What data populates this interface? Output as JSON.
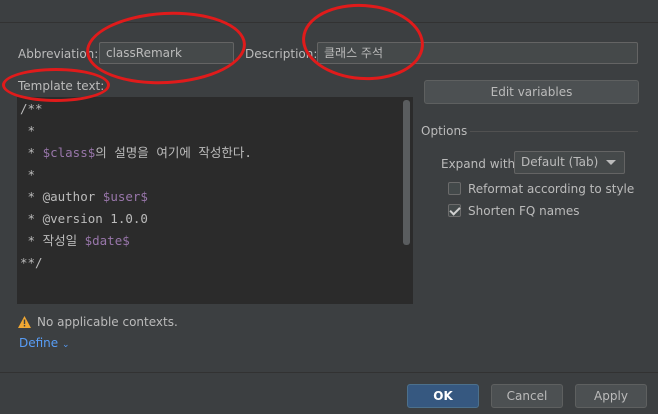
{
  "form": {
    "abbreviation_label": "Abbreviation:",
    "abbreviation_value": "classRemark",
    "description_label": "Description:",
    "description_value": "클래스 주석",
    "template_label": "Template text:"
  },
  "template_lines": [
    {
      "text": "/**"
    },
    {
      "text": " *"
    },
    {
      "pre": " * ",
      "var": "$class$",
      "post": "의 설명을 여기에 작성한다."
    },
    {
      "text": " *"
    },
    {
      "pre": " * @author ",
      "var": "$user$",
      "post": ""
    },
    {
      "text": " * @version 1.0.0"
    },
    {
      "pre": " * 작성일 ",
      "var": "$date$",
      "post": ""
    },
    {
      "text": "**/"
    }
  ],
  "right_panel": {
    "edit_variables": "Edit variables",
    "options_title": "Options",
    "expand_with_label": "Expand with",
    "expand_with_value": "Default (Tab)",
    "reformat_label": "Reformat according to style",
    "reformat_checked": false,
    "shorten_label": "Shorten FQ names",
    "shorten_checked": true
  },
  "contexts": {
    "warning_text": "No applicable contexts.",
    "define_label": "Define"
  },
  "buttons": {
    "ok": "OK",
    "cancel": "Cancel",
    "apply": "Apply"
  },
  "colors": {
    "background": "#3c3f41",
    "editor_bg": "#2b2b2b",
    "variable": "#9876aa",
    "link": "#589df6",
    "annotation": "#e01b1b"
  }
}
